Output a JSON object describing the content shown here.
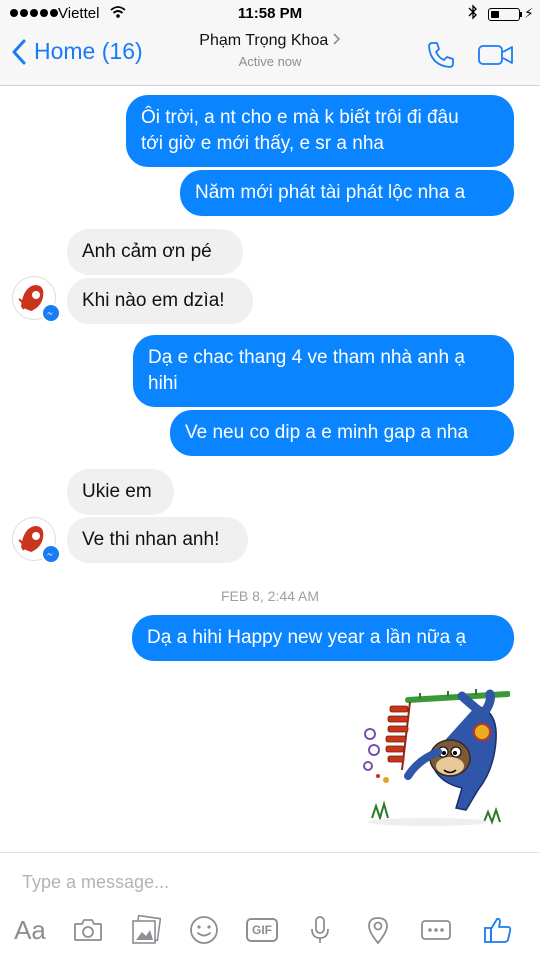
{
  "status_bar": {
    "carrier": "Viettel",
    "time": "11:58 PM",
    "battery_level": 0.3
  },
  "header": {
    "back_label": "Home (16)",
    "contact_name": "Phạm Trọng Khoa",
    "contact_status": "Active now"
  },
  "messages": [
    {
      "text_lines": [
        "Ôi trời, a nt cho e mà k biết trôi đi đâu",
        "tới giờ e mới thấy, e sr a nha"
      ]
    },
    {
      "text": "Năm mới phát tài phát lộc nha a"
    },
    {
      "text": "Anh cảm ơn pé"
    },
    {
      "text": "Khi nào em dzìa!"
    },
    {
      "text_lines": [
        "Dạ e chac thang 4 ve tham nhà anh ạ",
        "hihi"
      ]
    },
    {
      "text": "Ve neu co dip a e minh gap a nha"
    },
    {
      "text": "Ukie em"
    },
    {
      "text": "Ve thi nhan anh!"
    },
    {
      "text": "Dạ a hihi Happy new year a lần nữa ạ"
    }
  ],
  "timestamp": "FEB 8, 2:44 AM",
  "composer": {
    "placeholder": "Type a message...",
    "aa_label": "Aa",
    "gif_label": "GIF"
  },
  "colors": {
    "accent": "#1a7cf5",
    "outgoing_bubble": "#0a84ff",
    "incoming_bubble": "#f0f0f0"
  },
  "icons": [
    "back-chevron-icon",
    "phone-icon",
    "video-camera-icon",
    "camera-icon",
    "photo-gallery-icon",
    "emoji-icon",
    "microphone-icon",
    "location-pin-icon",
    "more-icon",
    "thumbs-up-icon"
  ]
}
